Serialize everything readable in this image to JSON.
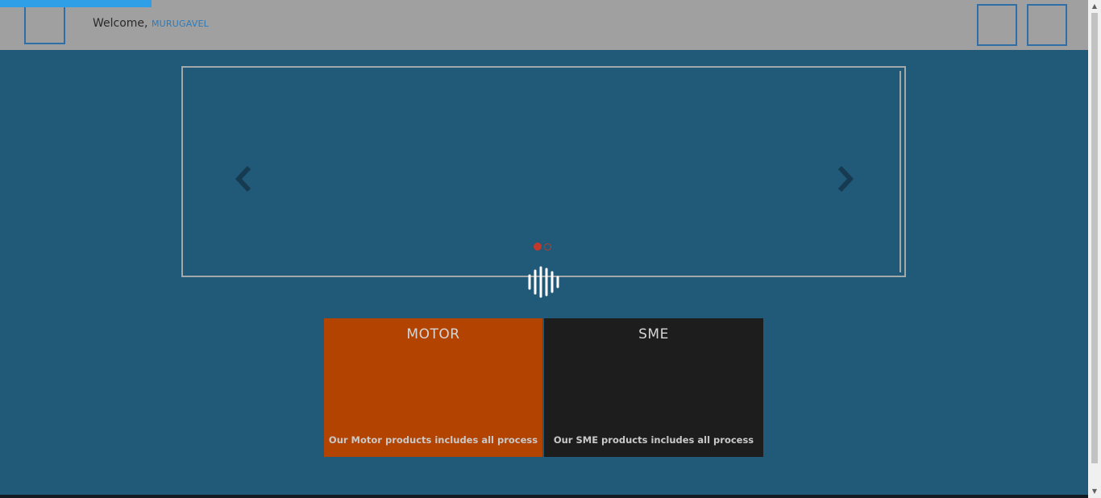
{
  "header": {
    "welcome_prefix": "Welcome,",
    "username": "MURUGAVEL"
  },
  "carousel": {
    "prev_icon": "chevron-left-icon",
    "next_icon": "chevron-right-icon",
    "slides_count_shown": 2,
    "active_slide": 1
  },
  "tiles": [
    {
      "title": "MOTOR",
      "description": "Our Motor products includes all process",
      "color": "#b34300"
    },
    {
      "title": "SME",
      "description": "Our SME products includes all process",
      "color": "#1e1d1d"
    }
  ],
  "colors": {
    "page_bg": "#215a78",
    "header_bg": "#a0a0a0",
    "accent": "#2f6fa8",
    "progress": "#2fa0e8",
    "indicator": "#c0392b"
  }
}
